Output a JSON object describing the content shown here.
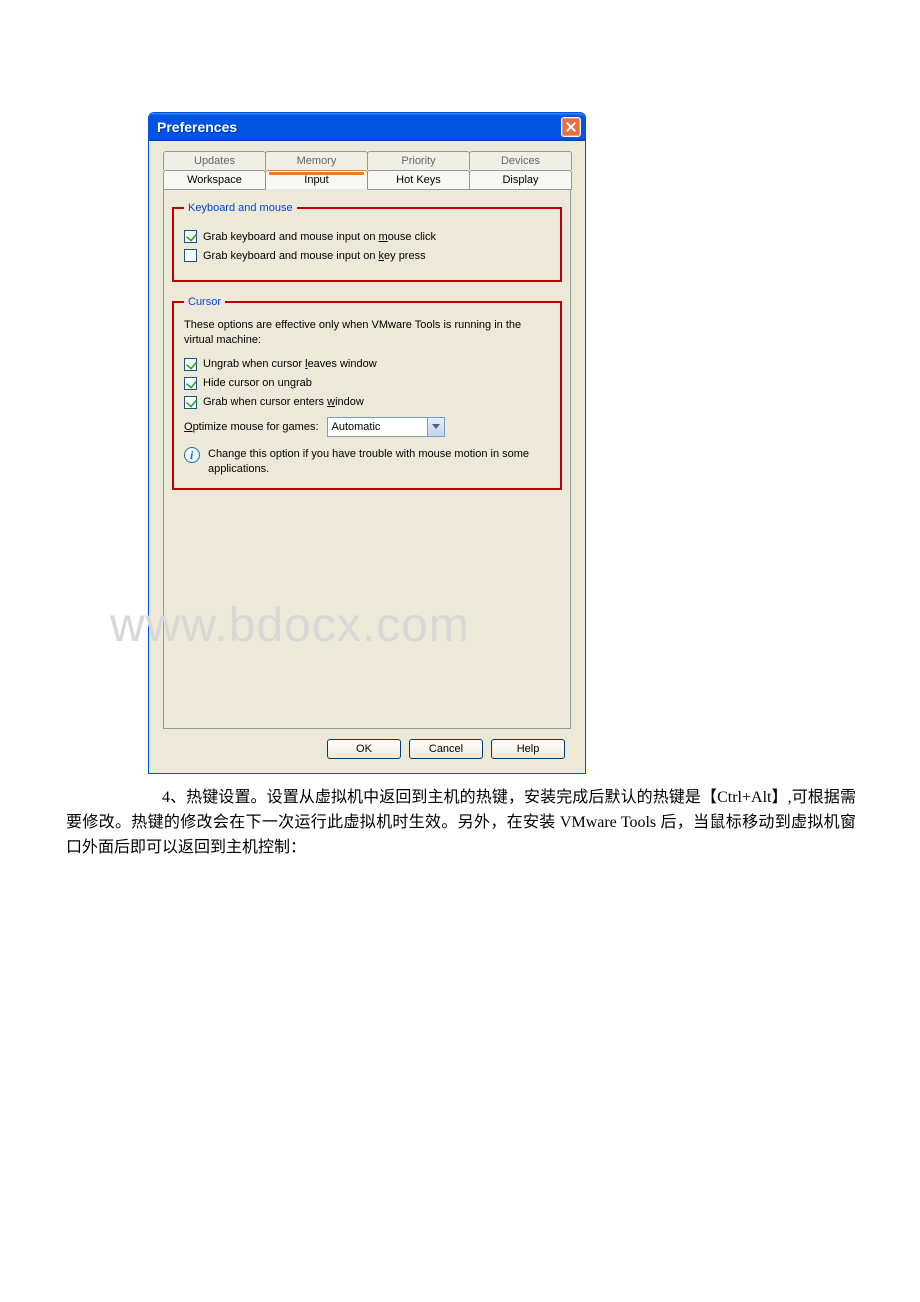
{
  "dialog": {
    "title": "Preferences",
    "tabs_back": [
      "Updates",
      "Memory",
      "Priority",
      "Devices"
    ],
    "tabs_front": [
      "Workspace",
      "Input",
      "Hot Keys",
      "Display"
    ],
    "active_tab": "Input",
    "group1": {
      "legend": "Keyboard and mouse",
      "chk1": {
        "label_pre": "Grab keyboard and mouse input on ",
        "u": "m",
        "label_post": "ouse click",
        "checked": true
      },
      "chk2": {
        "label_pre": "Grab keyboard and mouse input on ",
        "u": "k",
        "label_post": "ey press",
        "checked": false
      }
    },
    "group2": {
      "legend": "Cursor",
      "note": "These options are effective only when VMware Tools is running in the virtual machine:",
      "chk3": {
        "label_pre": "Ungrab when cursor ",
        "u": "l",
        "label_post": "eaves window",
        "checked": true
      },
      "chk4": {
        "label_pre": "Hide cursor on un",
        "u": "g",
        "label_post": "rab",
        "checked": true
      },
      "chk5": {
        "label_pre": "Grab when cursor enters ",
        "u": "w",
        "label_post": "indow",
        "checked": true
      },
      "opt_label_u": "O",
      "opt_label_post": "ptimize mouse for games:",
      "opt_value": "Automatic",
      "info": "Change this option if you have trouble with mouse motion in some applications."
    },
    "buttons": {
      "ok": "OK",
      "cancel": "Cancel",
      "help": "Help"
    }
  },
  "watermark": "www.bdocx.com",
  "caption": "4、热键设置。设置从虚拟机中返回到主机的热键，安装完成后默认的热键是【Ctrl+Alt】,可根据需要修改。热键的修改会在下一次运行此虚拟机时生效。另外，在安装 VMware Tools 后，当鼠标移动到虚拟机窗口外面后即可以返回到主机控制："
}
